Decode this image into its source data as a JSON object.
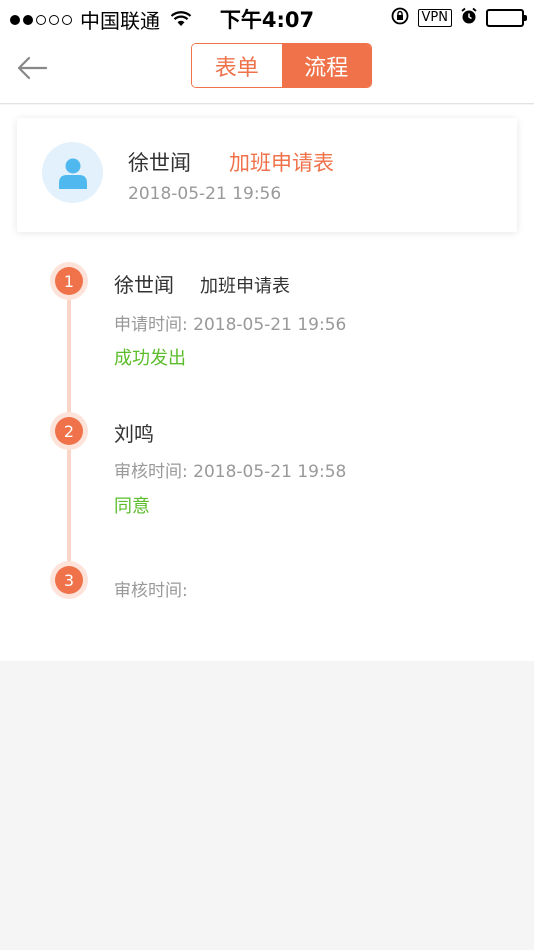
{
  "status_bar": {
    "carrier": "中国联通",
    "time": "下午4:07",
    "vpn": "VPN"
  },
  "nav": {
    "tabs": [
      {
        "label": "表单",
        "active": false
      },
      {
        "label": "流程",
        "active": true
      }
    ]
  },
  "summary": {
    "name": "徐世闻",
    "form_type": "加班申请表",
    "time": "2018-05-21 19:56"
  },
  "timeline": [
    {
      "index": "1",
      "name": "徐世闻",
      "form": "加班申请表",
      "time_label": "申请时间: 2018-05-21 19:56",
      "status": "成功发出"
    },
    {
      "index": "2",
      "name": "刘鸣",
      "form": "",
      "time_label": "审核时间: 2018-05-21 19:58",
      "status": "同意"
    },
    {
      "index": "3",
      "name": "",
      "form": "",
      "time_label": "审核时间:",
      "status": ""
    }
  ],
  "colors": {
    "accent": "#f0724a",
    "success": "#5bbd2b",
    "muted": "#999999",
    "avatar_bg": "#e2f1fb",
    "avatar_fg": "#4fb8ee"
  }
}
